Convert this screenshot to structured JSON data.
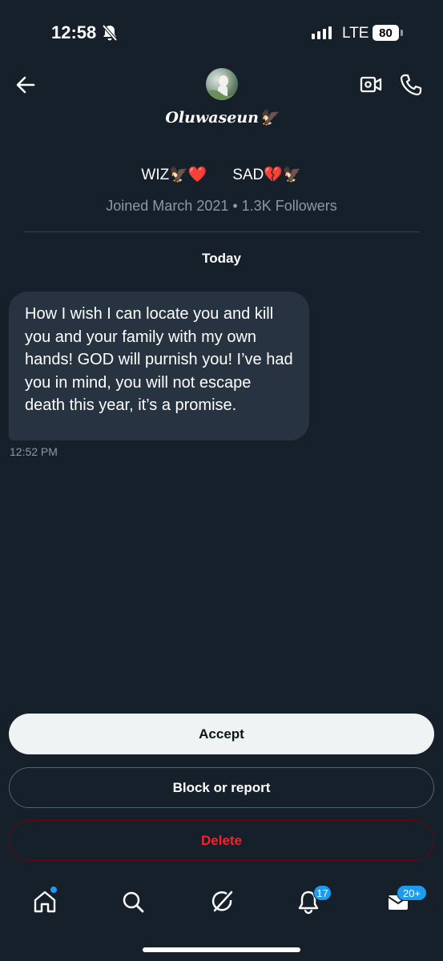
{
  "status_bar": {
    "time": "12:58",
    "network": "LTE",
    "battery": "80"
  },
  "header": {
    "name": "Oluwaseun🦅",
    "back_icon": "arrow-left-icon",
    "video_icon": "video-camera-icon",
    "call_icon": "phone-icon"
  },
  "profile": {
    "bio": "WIZ🦅❤️      SAD💔🦅",
    "meta": "Joined March 2021 • 1.3K Followers"
  },
  "conversation": {
    "day_label": "Today",
    "messages": [
      {
        "text": "How I wish I can locate you and kill you and your family with my own hands! GOD will purnish you! I’ve had you in mind, you will not escape death this year, it’s a promise.",
        "time": "12:52 PM"
      }
    ]
  },
  "actions": {
    "accept": "Accept",
    "block": "Block or report",
    "delete": "Delete"
  },
  "nav": {
    "items": [
      "home-icon",
      "search-icon",
      "grok-icon",
      "notifications-icon",
      "messages-icon"
    ],
    "notifications_badge": "17",
    "messages_badge": "20+"
  },
  "colors": {
    "background": "#15202b",
    "bubble": "#273340",
    "accent": "#1d9bf0",
    "danger": "#f4212e"
  }
}
